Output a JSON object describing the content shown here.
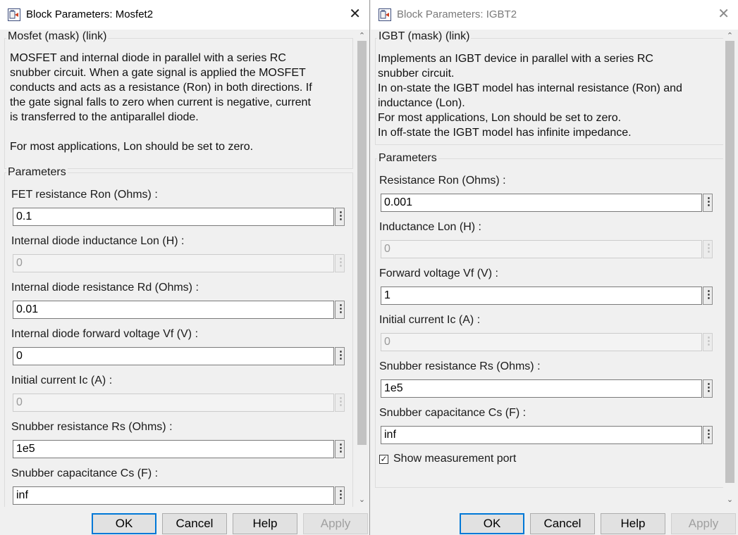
{
  "windows": [
    {
      "title": "Block Parameters: Mosfet2",
      "header": "Mosfet (mask) (link)",
      "description": [
        "MOSFET and internal  diode in parallel with a series RC",
        "snubber circuit. When a gate signal is applied the MOSFET",
        "conducts and acts as a resistance (Ron) in both directions. If",
        "the gate signal falls to zero when current is negative, current",
        "is transferred to the antiparallel diode.",
        "",
        "For most applications, Lon should be set to zero."
      ],
      "params_title": "Parameters",
      "params": [
        {
          "label": "FET resistance Ron (Ohms) :",
          "value": "0.1",
          "enabled": true
        },
        {
          "label": "Internal diode inductance Lon (H) :",
          "value": "0",
          "enabled": false
        },
        {
          "label": "Internal diode resistance Rd  (Ohms) :",
          "value": "0.01",
          "enabled": true
        },
        {
          "label": "Internal diode forward voltage Vf (V) :",
          "value": "0",
          "enabled": true
        },
        {
          "label": "Initial current Ic (A) :",
          "value": "0",
          "enabled": false
        },
        {
          "label": "Snubber resistance Rs (Ohms) :",
          "value": "1e5",
          "enabled": true
        },
        {
          "label": "Snubber capacitance Cs (F) :",
          "value": "inf",
          "enabled": true
        }
      ],
      "buttons": {
        "ok": "OK",
        "cancel": "Cancel",
        "help": "Help",
        "apply": "Apply"
      }
    },
    {
      "title": "Block Parameters: IGBT2",
      "header": "IGBT (mask) (link)",
      "description": [
        "Implements an IGBT device  in parallel with a series RC",
        "snubber circuit.",
        "In on-state the IGBT model has internal resistance (Ron) and",
        "inductance (Lon).",
        "For most applications, Lon should be set to zero.",
        "In off-state the IGBT model has infinite impedance."
      ],
      "params_title": "Parameters",
      "params": [
        {
          "label": "Resistance Ron (Ohms) :",
          "value": "0.001",
          "enabled": true
        },
        {
          "label": "Inductance Lon (H) :",
          "value": "0",
          "enabled": false
        },
        {
          "label": "Forward voltage Vf (V) :",
          "value": "1",
          "enabled": true
        },
        {
          "label": "Initial current Ic (A) :",
          "value": "0",
          "enabled": false
        },
        {
          "label": "Snubber resistance Rs (Ohms) :",
          "value": "1e5",
          "enabled": true
        },
        {
          "label": "Snubber capacitance Cs (F) :",
          "value": "inf",
          "enabled": true
        }
      ],
      "checkbox": {
        "label": "Show measurement port",
        "checked": true
      },
      "buttons": {
        "ok": "OK",
        "cancel": "Cancel",
        "help": "Help",
        "apply": "Apply"
      }
    }
  ],
  "icons": {
    "window": "simulink-block-icon",
    "close": "close-icon",
    "more": "more-options-icon"
  },
  "colors": {
    "default_button_border": "#0078d7",
    "field_border": "#7a7a7a",
    "background": "#f0f0f0"
  }
}
